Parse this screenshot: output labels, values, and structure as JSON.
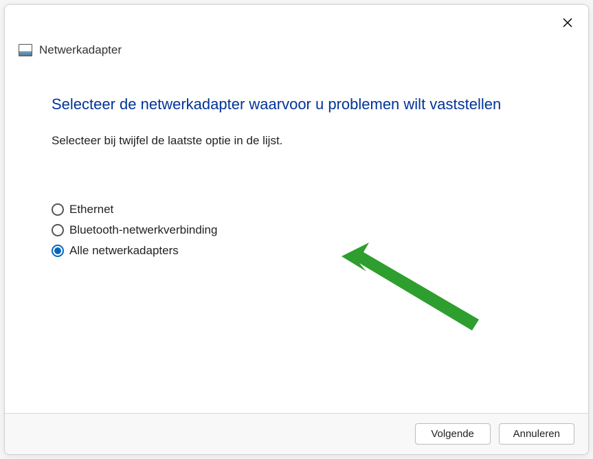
{
  "header": {
    "title": "Netwerkadapter"
  },
  "content": {
    "heading": "Selecteer de netwerkadapter waarvoor u problemen wilt vaststellen",
    "instruction": "Selecteer bij twijfel de laatste optie in de lijst.",
    "options": [
      {
        "label": "Ethernet",
        "selected": false
      },
      {
        "label": "Bluetooth-netwerkverbinding",
        "selected": false
      },
      {
        "label": "Alle netwerkadapters",
        "selected": true
      }
    ]
  },
  "footer": {
    "next": "Volgende",
    "cancel": "Annuleren"
  },
  "colors": {
    "accent": "#0067c0",
    "heading": "#003399",
    "arrow": "#2e9e2e"
  }
}
